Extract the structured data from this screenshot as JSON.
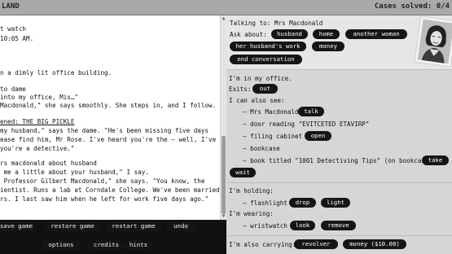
{
  "titlebar": {
    "title": "LAND",
    "cases": "Cases solved: 0/4"
  },
  "story": {
    "lines": [
      "",
      "",
      "t watch",
      "10:05 AM.",
      "",
      "",
      "n a dimly lit office building.",
      "",
      "to dame",
      "into my office, Mis…\"",
      "Macdonald,\" she says smoothly. She steps in, and I follow.",
      "",
      "ened: THE BIG PICKLE",
      "my husband,\" says the dame. \"He's been missing five days",
      "ease find him, Mr Rose. I've heard you're the – well, I've",
      "you're a detective.\"",
      "",
      "rs macdonald about husband",
      " me a little about your husband,\" I say.",
      " Professor Gilbert Macdonald,\" she says. \"You know, the",
      "ientist. Runs a lab at Corndale College. We've been married",
      "rs. I last saw him when he left for work five days ago.\""
    ]
  },
  "bottombar": {
    "save_game": "save game",
    "restore_game": "restore game",
    "restart_game": "restart game",
    "undo": "undo",
    "options": "options",
    "credits": "credits",
    "hints": "hints"
  },
  "talk": {
    "talking_to": "Talking to: Mrs Macdonald",
    "ask_about": "Ask about:",
    "topics": [
      "husband",
      "home",
      "another woman",
      "her husband's work",
      "money"
    ],
    "end_conversation": "end conversation"
  },
  "location": {
    "in_office": "I'm in my office.",
    "exits_label": "Exits:",
    "exit_out": "out",
    "can_also_see": "I can also see:",
    "items": [
      {
        "text": "– Mrs Macdonald",
        "action": "talk"
      },
      {
        "text": "– door reading \"EVITCETED ETAVIRP\""
      },
      {
        "text": "– filing cabinet",
        "action": "open"
      },
      {
        "text": "– bookcase"
      },
      {
        "text": "– book titled \"1001 Detectiving Tips\" (on bookcase)",
        "action": "take"
      }
    ],
    "wait": "wait"
  },
  "inventory": {
    "holding_label": "I'm holding:",
    "holding_item": "– flashlight",
    "holding_actions": [
      "drop",
      "light"
    ],
    "wearing_label": "I'm wearing:",
    "wearing_item": "– wristwatch",
    "wearing_actions": [
      "look",
      "remove"
    ],
    "carrying_label": "I'm also carrying:",
    "carrying_items": [
      "revolver",
      "money ($10.00)"
    ]
  }
}
